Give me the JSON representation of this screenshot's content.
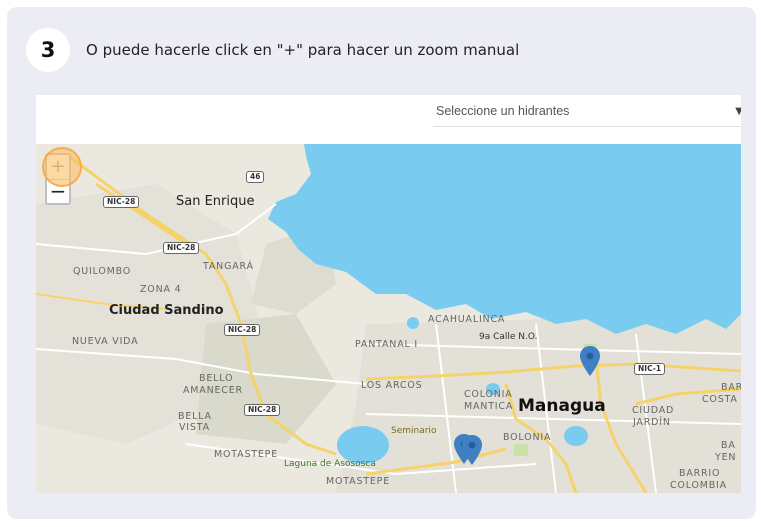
{
  "step": {
    "number": "3",
    "text": "O puede hacerle click en \"+\" para hacer un zoom manual"
  },
  "select": {
    "label": "Seleccione un hidrantes"
  },
  "zoom": {
    "in_label": "+",
    "out_label": "−"
  },
  "map": {
    "water_color": "#79ccef",
    "land_color": "#ebe8e0",
    "road_color": "#f6d36a",
    "pin_color": "#3f7fc4",
    "labels": {
      "san_enrique": "San Enrique",
      "quilombo": "QUILOMBO",
      "zona4": "ZONA 4",
      "tangara": "TANGARÁ",
      "ciudad_sandino": "Ciudad Sandino",
      "nueva_vida": "NUEVA VIDA",
      "bello_amanecer_1": "BELLO",
      "bello_amanecer_2": "AMANECER",
      "bella_vista_1": "BELLA",
      "bella_vista_2": "VISTA",
      "motastepe_1": "MOTASTEPE",
      "motastepe_2": "MOTASTEPE",
      "acahualinca": "ACAHUALINCA",
      "pantanal": "PANTANAL I",
      "calle": "9a Calle N.O.",
      "los_arcos": "LOS ARCOS",
      "colonia_1": "COLONIA",
      "colonia_2": "MANTICA",
      "managua": "Managua",
      "seminario": "Seminario",
      "laguna": "Laguna de Asososca",
      "bolonia": "BOLONIA",
      "ciudad_jardin_1": "CIUDAD",
      "ciudad_jardin_2": "JARDÍN",
      "barrio_1": "BAR",
      "barrio_2": "COSTA",
      "bar_yen_1": "BA",
      "bar_yen_2": "YEN",
      "barrio_colombia_1": "BARRIO",
      "barrio_colombia_2": "COLOMBIA"
    },
    "shields": {
      "nic28_a": "NIC-28",
      "nic28_b": "NIC-28",
      "nic28_c": "NIC-28",
      "nic28_d": "NIC-28",
      "nic1": "NIC-1",
      "r46": "46"
    }
  }
}
